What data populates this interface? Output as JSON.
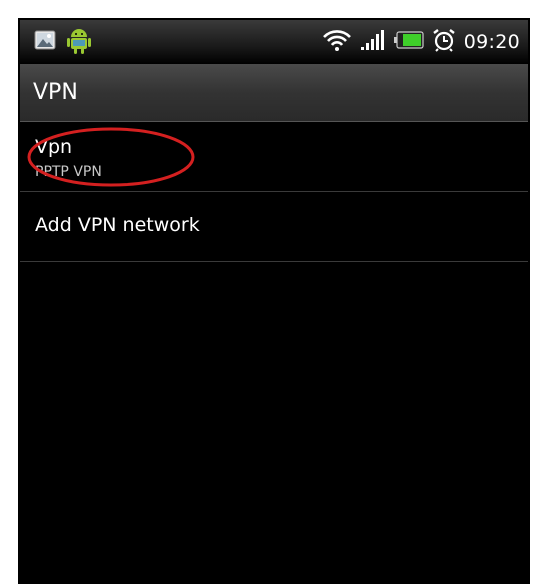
{
  "status_bar": {
    "time": "09:20",
    "icons": [
      "gallery-icon",
      "android-icon",
      "wifi-icon",
      "signal-icon",
      "battery-icon",
      "alarm-icon"
    ],
    "battery_color": "#3fcf2a",
    "wifi_color": "#ffffff"
  },
  "title_bar": {
    "title": "VPN"
  },
  "vpn_list": [
    {
      "title": "Vpn",
      "subtitle": "PPTP VPN"
    },
    {
      "title": "Add VPN network"
    }
  ],
  "colors": {
    "background": "#000000",
    "highlight": "#d42020"
  }
}
